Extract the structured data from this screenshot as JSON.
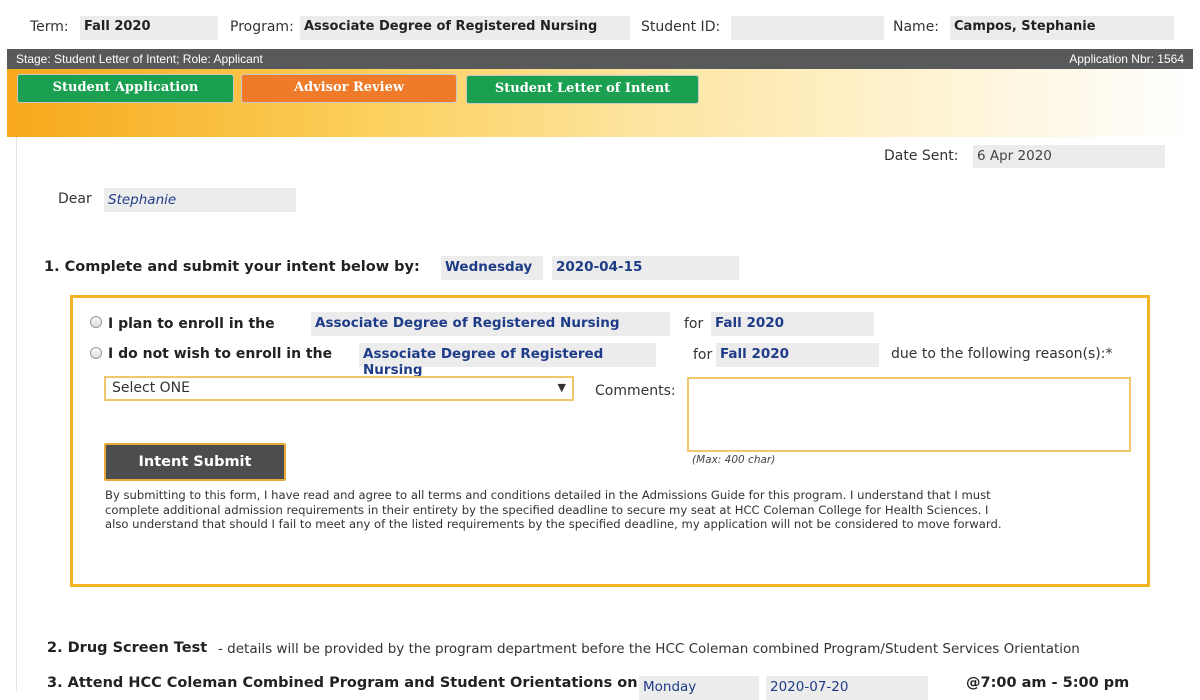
{
  "header": {
    "term_label": "Term:",
    "term_value": "Fall 2020",
    "program_label": "Program:",
    "program_value": "Associate Degree of Registered Nursing",
    "student_id_label": "Student ID:",
    "student_id_value": "",
    "name_label": "Name:",
    "name_value": "Campos, Stephanie"
  },
  "stage_bar": {
    "stage_text": "Stage:  Student Letter of Intent;  Role:  Applicant",
    "application_nbr": "Application Nbr:  1564"
  },
  "tabs": [
    {
      "label": "Student Application",
      "color": "#1aa050"
    },
    {
      "label": "Advisor Review",
      "color": "#ee7a2a"
    },
    {
      "label": "Student Letter of Intent",
      "color": "#1aa050"
    }
  ],
  "letter": {
    "date_sent_label": "Date Sent:",
    "date_sent_value": "6 Apr 2020",
    "dear_label": "Dear",
    "dear_value": "Stephanie",
    "step1_label": "1.  Complete and submit your intent below by:",
    "due_day": "Wednesday",
    "due_date": "2020-04-15"
  },
  "intent_form": {
    "option_enroll_label": "I plan to enroll in the",
    "option_enroll_program": "Associate Degree of Registered Nursing",
    "option_enroll_for": "for",
    "option_enroll_term": "Fall 2020",
    "option_decline_label": "I do not wish to enroll in the",
    "option_decline_program": "Associate Degree of Registered Nursing",
    "option_decline_for": "for",
    "option_decline_term": "Fall 2020",
    "reason_label": "due to the following reason(s):*",
    "reason_select_value": "Select ONE",
    "comments_label": "Comments:",
    "comments_max": "(Max: 400 char)",
    "submit_label": "Intent Submit",
    "disclaimer": "By submitting to this form, I have read and agree to all terms and conditions detailed in the Admissions Guide for this program. I understand that I must complete additional admission requirements in their entirety by the specified deadline to secure my seat at HCC Coleman College for Health Sciences.  I also understand that should I fail to meet any of the listed requirements by the specified deadline, my application will not be considered to move forward."
  },
  "steps": {
    "step2_label": "2. Drug Screen Test",
    "step2_detail": "- details will be provided by the program department before the HCC Coleman combined Program/Student Services Orientation",
    "step3_label": "3. Attend HCC Coleman Combined Program and Student Orientations on",
    "step3_day": "Monday",
    "step3_date": "2020-07-20",
    "step3_time": "@7:00 am - 5:00 pm"
  },
  "colors": {
    "accent_orange": "#f2b51f",
    "stage_bar": "#58595b",
    "link_blue": "#1f3c88"
  }
}
